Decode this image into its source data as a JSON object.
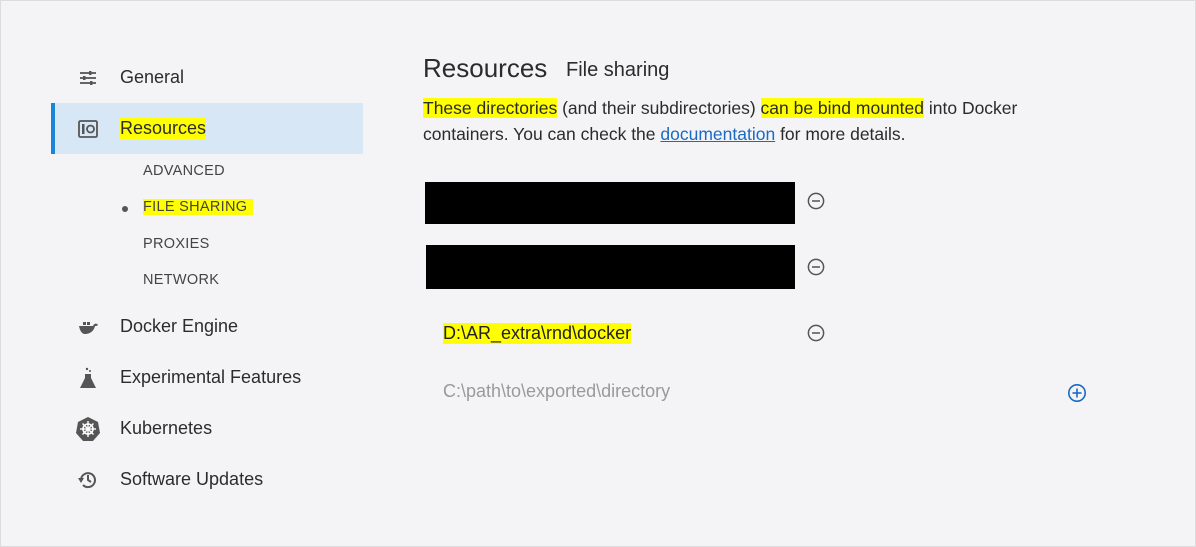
{
  "sidebar": {
    "items": [
      {
        "label": "General",
        "icon": "sliders-icon"
      },
      {
        "label": "Resources",
        "icon": "resources-icon"
      },
      {
        "label": "Docker Engine",
        "icon": "whale-icon"
      },
      {
        "label": "Experimental Features",
        "icon": "flask-icon"
      },
      {
        "label": "Kubernetes",
        "icon": "helm-icon"
      },
      {
        "label": "Software Updates",
        "icon": "history-icon"
      }
    ],
    "subitems": [
      "ADVANCED",
      "FILE SHARING",
      "PROXIES",
      "NETWORK"
    ],
    "active_item": "Resources",
    "active_subitem": "FILE SHARING"
  },
  "main": {
    "title": "Resources",
    "subtitle": "File sharing",
    "description": {
      "part1": "These directories",
      "part2": " (and their subdirectories) ",
      "part3": "can be bind mounted",
      "part4": " into Docker containers. You can check the ",
      "link": "documentation",
      "part5": " for more details."
    },
    "directories": [
      "",
      "",
      "D:\\AR_extra\\rnd\\docker"
    ],
    "new_path_placeholder": "C:\\path\\to\\exported\\directory"
  },
  "colors": {
    "accent": "#1a84d6",
    "active_bg": "#d7e7f5",
    "highlight": "#ffff00",
    "link": "#1a6ac4"
  }
}
